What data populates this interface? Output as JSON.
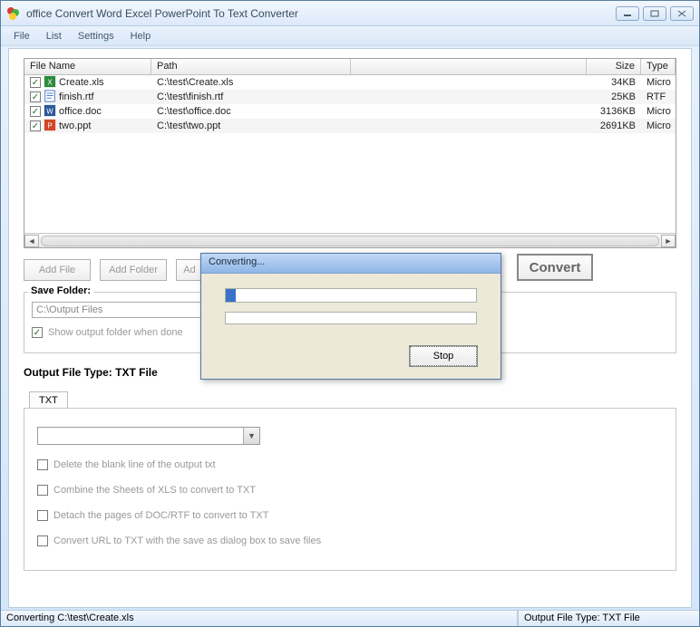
{
  "app": {
    "title": "office Convert Word Excel PowerPoint To Text Converter"
  },
  "menu": {
    "file": "File",
    "list": "List",
    "settings": "Settings",
    "help": "Help"
  },
  "columns": {
    "name": "File Name",
    "path": "Path",
    "size": "Size",
    "type": "Type"
  },
  "files": [
    {
      "name": "Create.xls",
      "path": "C:\\test\\Create.xls",
      "size": "34KB",
      "type": "Micro",
      "icon": "xls"
    },
    {
      "name": "finish.rtf",
      "path": "C:\\test\\finish.rtf",
      "size": "25KB",
      "type": "RTF",
      "icon": "rtf"
    },
    {
      "name": "office.doc",
      "path": "C:\\test\\office.doc",
      "size": "3136KB",
      "type": "Micro",
      "icon": "doc"
    },
    {
      "name": "two.ppt",
      "path": "C:\\test\\two.ppt",
      "size": "2691KB",
      "type": "Micro",
      "icon": "ppt"
    }
  ],
  "buttons": {
    "add_file": "Add File",
    "add_folder": "Add Folder",
    "add": "Ad",
    "convert": "Convert"
  },
  "save": {
    "title": "Save Folder:",
    "path": "C:\\Output Files",
    "show_when_done": "Show output folder when done"
  },
  "output": {
    "label_prefix": "Output File Type:  ",
    "label_value": "TXT File"
  },
  "tab": {
    "txt": "TXT"
  },
  "options": {
    "delete_blank": "Delete the blank line of the output txt",
    "combine_sheets": "Combine the Sheets of XLS to convert to TXT",
    "detach_pages": "Detach the pages of DOC/RTF to convert to TXT",
    "convert_url": "Convert URL to TXT with the save as dialog box to save files"
  },
  "dialog": {
    "title": "Converting...",
    "stop": "Stop",
    "progress_percent": 4
  },
  "status": {
    "left": "Converting  C:\\test\\Create.xls",
    "right": "Output File Type:  TXT File"
  }
}
